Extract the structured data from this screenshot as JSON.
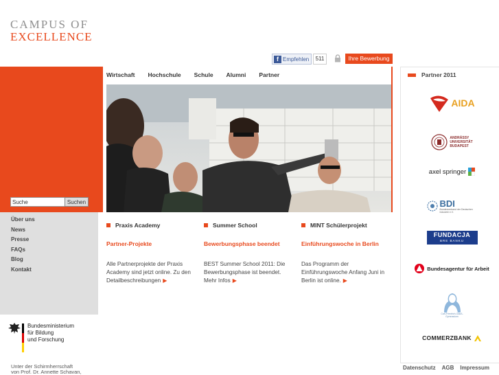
{
  "logo": {
    "line1": "CAMPUS OF",
    "line2": "EXCELLENCE"
  },
  "topbar": {
    "facebook_label": "Empfehlen",
    "facebook_count": "511",
    "apply_label": "Ihre Bewerbung"
  },
  "nav": [
    "Wirtschaft",
    "Hochschule",
    "Schule",
    "Alumni",
    "Partner"
  ],
  "search": {
    "value": "Suche",
    "button": "Suchen"
  },
  "leftnav": [
    "Über uns",
    "News",
    "Presse",
    "FAQs",
    "Blog",
    "Kontakt"
  ],
  "bmbf": {
    "line1": "Bundesministerium",
    "line2": "für Bildung",
    "line3": "und Forschung"
  },
  "patron": {
    "line1": "Unter der Schirmherrschaft",
    "line2": "von Prof. Dr. Annette Schavan,"
  },
  "columns": [
    {
      "head": "Praxis Academy",
      "title": "Partner-Projekte",
      "body": "Alle Partnerprojekte der Praxis Academy sind jetzt online. Zu den Detailbeschreibungen"
    },
    {
      "head": "Summer School",
      "title": "Bewerbungsphase beendet",
      "body": "BEST Summer School 2011: Die Bewerbungsphase ist beendet. Mehr Infos"
    },
    {
      "head": "MINT Schülerprojekt",
      "title": "Einführungswoche in Berlin",
      "body": "Das Programm der Einführungswoche Anfang Juni in Berlin ist online."
    }
  ],
  "partners": {
    "heading": "Partner 2011",
    "aida": "AIDA",
    "andrassy": {
      "l1": "ANDRÁSSY",
      "l2": "UNIVERSITÄT",
      "l3": "BUDAPEST"
    },
    "springer": "axel springer",
    "bdi": "BDI",
    "bdi_sub": "Bundesverband der Deutschen Industrie e.V.",
    "fundacja": "FUNDACJA",
    "fundacja_sub": "BRE BANKU",
    "arbeit": "Bundesagentur für Arbeit",
    "gauss": "Carl-Friedrich-Gauß-Gymnasium",
    "commerzbank": "COMMERZBANK"
  },
  "footer": [
    "Datenschutz",
    "AGB",
    "Impressum"
  ],
  "colors": {
    "accent": "#e8491d",
    "gray_panel": "#dfdfdf"
  }
}
